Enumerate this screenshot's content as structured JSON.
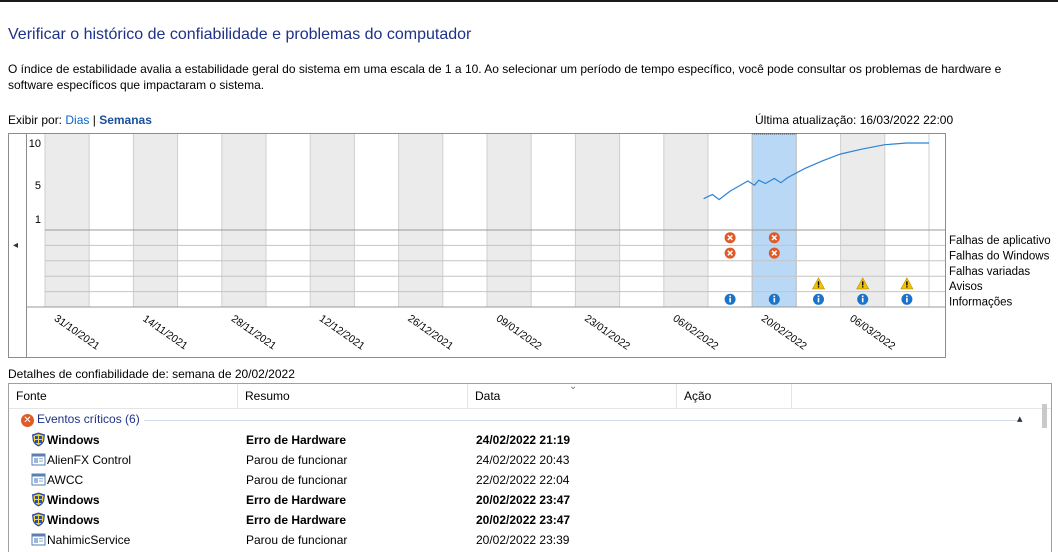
{
  "header": {
    "title": "Verificar o histórico de confiabilidade e problemas do computador",
    "description": "O índice de estabilidade avalia a estabilidade geral do sistema em uma escala de 1 a 10. Ao selecionar um período de tempo específico, você pode consultar os problemas de hardware e software específicos que impactaram o sistema."
  },
  "viewby": {
    "label": "Exibir por:",
    "days": "Dias",
    "separator": "|",
    "weeks": "Semanas",
    "active": "weeks"
  },
  "last_update": "Última atualização: 16/03/2022 22:00",
  "chart": {
    "y_ticks": [
      "10",
      "5",
      "1"
    ],
    "rows": [
      "Falhas de aplicativo",
      "Falhas do Windows",
      "Falhas variadas",
      "Avisos",
      "Informações"
    ],
    "dates": [
      "31/10/2021",
      "14/11/2021",
      "28/11/2021",
      "12/12/2021",
      "26/12/2021",
      "09/01/2022",
      "23/01/2022",
      "06/02/2022",
      "20/02/2022",
      "06/03/2022"
    ],
    "selected_column": 16,
    "nav_left": "◂",
    "icon_names": {
      "error": "error-icon",
      "warning": "warning-icon",
      "info": "info-icon"
    }
  },
  "chart_data": {
    "type": "line",
    "ylim": [
      1,
      10
    ],
    "columns": 20,
    "stability_index": [
      {
        "column": 14.9,
        "value": 3.4
      },
      {
        "column": 15.1,
        "value": 3.9
      },
      {
        "column": 15.25,
        "value": 3.3
      },
      {
        "column": 15.5,
        "value": 4.3
      },
      {
        "column": 15.7,
        "value": 4.9
      },
      {
        "column": 15.9,
        "value": 5.5
      },
      {
        "column": 16.05,
        "value": 5.0
      },
      {
        "column": 16.15,
        "value": 5.6
      },
      {
        "column": 16.3,
        "value": 5.2
      },
      {
        "column": 16.5,
        "value": 5.8
      },
      {
        "column": 16.65,
        "value": 5.3
      },
      {
        "column": 16.8,
        "value": 5.9
      },
      {
        "column": 17.2,
        "value": 7.0
      },
      {
        "column": 17.6,
        "value": 7.9
      },
      {
        "column": 18.0,
        "value": 8.7
      },
      {
        "column": 18.5,
        "value": 9.3
      },
      {
        "column": 19.0,
        "value": 9.8
      },
      {
        "column": 19.5,
        "value": 10
      },
      {
        "column": 20,
        "value": 10
      }
    ],
    "events": [
      {
        "column": 15,
        "row": 0,
        "kind": "error"
      },
      {
        "column": 15,
        "row": 1,
        "kind": "error"
      },
      {
        "column": 16,
        "row": 0,
        "kind": "error"
      },
      {
        "column": 16,
        "row": 1,
        "kind": "error"
      },
      {
        "column": 17,
        "row": 3,
        "kind": "warning"
      },
      {
        "column": 18,
        "row": 3,
        "kind": "warning"
      },
      {
        "column": 19,
        "row": 3,
        "kind": "warning"
      },
      {
        "column": 15,
        "row": 4,
        "kind": "info"
      },
      {
        "column": 16,
        "row": 4,
        "kind": "info"
      },
      {
        "column": 17,
        "row": 4,
        "kind": "info"
      },
      {
        "column": 18,
        "row": 4,
        "kind": "info"
      },
      {
        "column": 19,
        "row": 4,
        "kind": "info"
      }
    ]
  },
  "details": {
    "heading": "Detalhes de confiabilidade de: semana de 20/02/2022",
    "columns": [
      "Fonte",
      "Resumo",
      "Data",
      "Ação"
    ],
    "group": {
      "label": "Eventos críticos (6)",
      "collapse": "▴"
    },
    "rows": [
      {
        "source": "Windows",
        "summary": "Erro de Hardware",
        "date": "24/02/2022 21:19",
        "bold": true,
        "icon": "windows-shield-icon"
      },
      {
        "source": "AlienFX Control",
        "summary": "Parou de funcionar",
        "date": "24/02/2022 20:43",
        "bold": false,
        "icon": "application-icon"
      },
      {
        "source": "AWCC",
        "summary": "Parou de funcionar",
        "date": "22/02/2022 22:04",
        "bold": false,
        "icon": "application-icon"
      },
      {
        "source": "Windows",
        "summary": "Erro de Hardware",
        "date": "20/02/2022 23:47",
        "bold": true,
        "icon": "windows-shield-icon"
      },
      {
        "source": "Windows",
        "summary": "Erro de Hardware",
        "date": "20/02/2022 23:47",
        "bold": true,
        "icon": "windows-shield-icon"
      },
      {
        "source": "NahimicService",
        "summary": "Parou de funcionar",
        "date": "20/02/2022 23:39",
        "bold": false,
        "icon": "application-icon"
      }
    ]
  },
  "colors": {
    "accent": "#1e3287",
    "link": "#0066cc",
    "line": "#2b84d8",
    "selected": "#b8d8f5",
    "error": "#e05a28",
    "warning": "#f2c200",
    "info": "#1a73c9"
  }
}
